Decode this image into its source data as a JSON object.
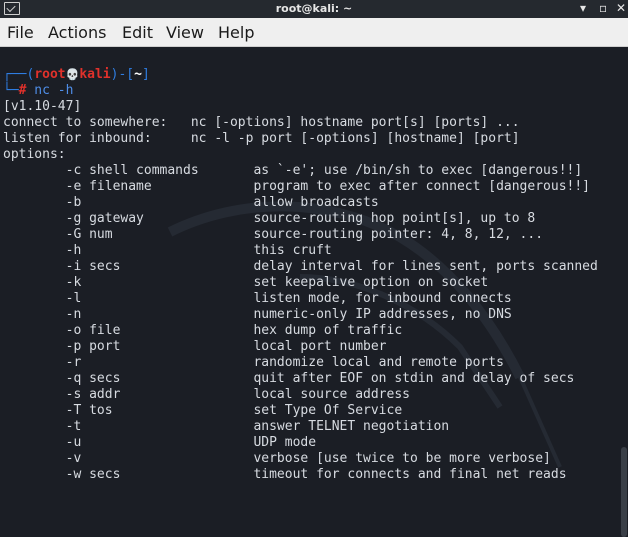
{
  "window": {
    "title": "root@kali: ~",
    "minimize": "▾",
    "maximize": "▫",
    "close": "✕"
  },
  "menu": [
    "File",
    "Actions",
    "Edit",
    "View",
    "Help"
  ],
  "prompt": {
    "open": "┌──(",
    "user": "root",
    "skull": "💀",
    "host": "kali",
    "mid": ")-[",
    "dir": "~",
    "close": "]",
    "second": "└─",
    "hash": "#",
    "command": " nc -h"
  },
  "output": [
    "[v1.10-47]",
    "connect to somewhere:   nc [-options] hostname port[s] [ports] ...",
    "listen for inbound:     nc -l -p port [-options] [hostname] [port]",
    "options:",
    "        -c shell commands       as `-e'; use /bin/sh to exec [dangerous!!]",
    "        -e filename             program to exec after connect [dangerous!!]",
    "        -b                      allow broadcasts",
    "        -g gateway              source-routing hop point[s], up to 8",
    "        -G num                  source-routing pointer: 4, 8, 12, ...",
    "        -h                      this cruft",
    "        -i secs                 delay interval for lines sent, ports scanned",
    "        -k                      set keepalive option on socket",
    "        -l                      listen mode, for inbound connects",
    "        -n                      numeric-only IP addresses, no DNS",
    "        -o file                 hex dump of traffic",
    "        -p port                 local port number",
    "        -r                      randomize local and remote ports",
    "        -q secs                 quit after EOF on stdin and delay of secs",
    "        -s addr                 local source address",
    "        -T tos                  set Type Of Service",
    "        -t                      answer TELNET negotiation",
    "        -u                      UDP mode",
    "        -v                      verbose [use twice to be more verbose]",
    "        -w secs                 timeout for connects and final net reads"
  ],
  "colors": {
    "prompt_frame": "#2f7de1",
    "prompt_user": "#e0312b",
    "command": "#4f8ee8",
    "text": "#d7dbe1",
    "background": "#1b1e25"
  }
}
